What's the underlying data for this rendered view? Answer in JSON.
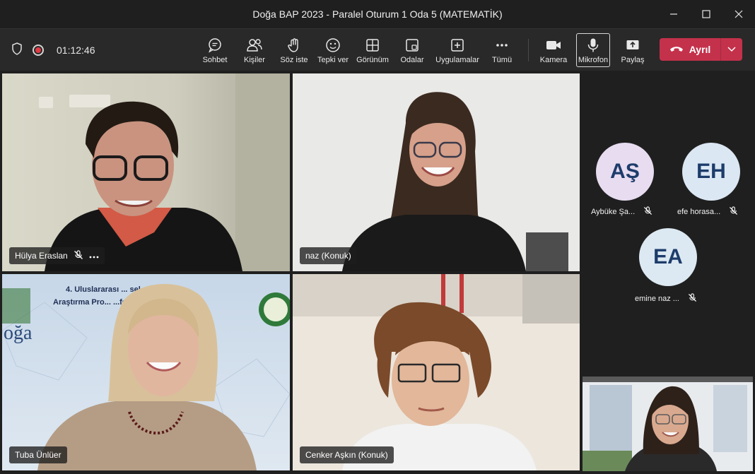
{
  "window": {
    "title": "Doğa BAP 2023 - Paralel Oturum 1 Oda 5 (MATEMATİK)"
  },
  "toolbar": {
    "timer": "01:12:46",
    "buttons": [
      {
        "label": "Sohbet",
        "icon": "chat-icon"
      },
      {
        "label": "Kişiler",
        "icon": "people-icon"
      },
      {
        "label": "Söz iste",
        "icon": "raise-hand-icon"
      },
      {
        "label": "Tepki ver",
        "icon": "smiley-icon"
      },
      {
        "label": "Görünüm",
        "icon": "layout-icon"
      },
      {
        "label": "Odalar",
        "icon": "breakout-rooms-icon"
      },
      {
        "label": "Uygulamalar",
        "icon": "add-apps-icon"
      },
      {
        "label": "Tümü",
        "icon": "more-icon"
      },
      {
        "label": "Kamera",
        "icon": "camera-icon"
      },
      {
        "label": "Mikrofon",
        "icon": "microphone-icon"
      },
      {
        "label": "Paylaş",
        "icon": "share-icon"
      }
    ],
    "leave_label": "Ayrıl"
  },
  "participants": {
    "video_tiles": [
      {
        "name": "Hülya Eraslan",
        "muted": true,
        "more": true
      },
      {
        "name": "naz (Konuk)",
        "muted": false,
        "more": false
      },
      {
        "name": "Tuba Ünlüer",
        "muted": false,
        "more": false
      },
      {
        "name": "Cenker Aşkın (Konuk)",
        "muted": false,
        "more": false
      }
    ],
    "avatars": [
      {
        "initials": "AŞ",
        "name": "Aybüke Şa...",
        "muted": true
      },
      {
        "initials": "EH",
        "name": "efe horasa...",
        "muted": true
      },
      {
        "initials": "EA",
        "name": "emine naz ...",
        "muted": true
      }
    ]
  },
  "colors": {
    "leave_button": "#c4314b",
    "avatar_ring_1": "#e7dcf0",
    "avatar_ring_2": "#dbe7f3",
    "avatar_ring_3": "#dce9f2",
    "recording_dot": "#e23b46"
  }
}
